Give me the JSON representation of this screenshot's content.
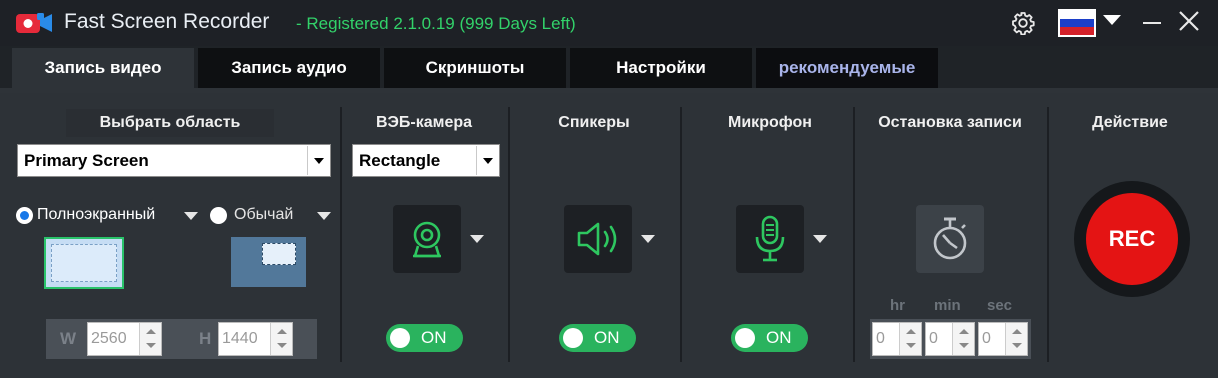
{
  "titlebar": {
    "app_title": "Fast Screen Recorder",
    "registration": "- Registered 2.1.0.19 (999 Days Left)"
  },
  "tabs": [
    {
      "label": "Запись видео",
      "active": true
    },
    {
      "label": "Запись аудио",
      "active": false
    },
    {
      "label": "Скриншоты",
      "active": false
    },
    {
      "label": "Настройки",
      "active": false
    },
    {
      "label": "рекомендуемые",
      "active": false
    }
  ],
  "area": {
    "title": "Выбрать область",
    "select_value": "Primary Screen",
    "mode_fullscreen": "Полноэкранный",
    "mode_custom": "Обычай",
    "selected_mode": "fullscreen",
    "width_label": "W",
    "width_value": "2560",
    "height_label": "H",
    "height_value": "1440"
  },
  "webcam": {
    "title": "ВЭБ-камера",
    "shape_value": "Rectangle",
    "toggle_label": "ON"
  },
  "speakers": {
    "title": "Спикеры",
    "toggle_label": "ON"
  },
  "microphone": {
    "title": "Микрофон",
    "toggle_label": "ON"
  },
  "stop": {
    "title": "Остановка записи",
    "hr_label": "hr",
    "min_label": "min",
    "sec_label": "sec",
    "hr_value": "0",
    "min_value": "0",
    "sec_value": "0"
  },
  "action": {
    "title": "Действие",
    "rec_label": "REC"
  },
  "colors": {
    "accent_green": "#2ab35e",
    "registration_green": "#32d26a",
    "rec_red": "#e41414",
    "radio_blue": "#1878e8"
  }
}
